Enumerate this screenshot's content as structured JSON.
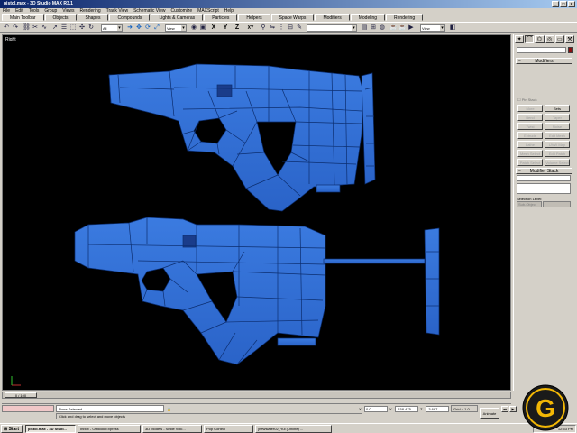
{
  "window": {
    "title": "pistol.max - 3D Studio MAX R3.1",
    "controls": [
      "_",
      "□",
      "×"
    ]
  },
  "menu": [
    "File",
    "Edit",
    "Tools",
    "Group",
    "Views",
    "Rendering",
    "Track View",
    "Schematic View",
    "Customize",
    "MAXScript",
    "Help"
  ],
  "tabs": [
    "Main Toolbar",
    "Objects",
    "Shapes",
    "Compounds",
    "Lights & Cameras",
    "Particles",
    "Helpers",
    "Space Warps",
    "Modifiers",
    "Modeling",
    "Rendering"
  ],
  "toolbar": {
    "selection_filter": "All",
    "ref_coord": "View",
    "axis_x": "X",
    "axis_y": "Y",
    "axis_z": "Z",
    "axis_xy": "XY",
    "named_selection": "",
    "render_view": "View"
  },
  "viewport": {
    "label": "Right",
    "background": "#000000",
    "model_color": "#2f6ed6"
  },
  "command_panel": {
    "tabs": [
      "create-icon",
      "modify-icon",
      "hierarchy-icon",
      "motion-icon",
      "display-icon",
      "utilities-icon"
    ],
    "object_color": "#8a1010",
    "modifiers_rollout": "Modifiers",
    "pin_stack": "Pin Stack",
    "modifier_buttons": [
      {
        "label": "More",
        "enabled": false
      },
      {
        "label": "Sets",
        "enabled": true
      },
      {
        "label": "Bend",
        "enabled": false
      },
      {
        "label": "Taper",
        "enabled": false
      },
      {
        "label": "Twist",
        "enabled": false
      },
      {
        "label": "Noise",
        "enabled": false
      },
      {
        "label": "Extrude",
        "enabled": false
      },
      {
        "label": "Edit Mesh",
        "enabled": false
      },
      {
        "label": "Lathe",
        "enabled": false
      },
      {
        "label": "UVW Map",
        "enabled": false
      },
      {
        "label": "Mesh Select",
        "enabled": false
      },
      {
        "label": "Edit Patch",
        "enabled": false
      },
      {
        "label": "Patch Select",
        "enabled": false
      },
      {
        "label": "Volume Select",
        "enabled": false
      }
    ],
    "stack_rollout": "Modifier Stack",
    "selection_level_label": "Selection Level:",
    "sub_object": "Sub-Object"
  },
  "time_slider": {
    "label": "0 / 100"
  },
  "status": {
    "selection": "None Selected",
    "prompt": "Click and drag to select and move objects",
    "x_label": "X",
    "x_value": "0.0",
    "y_label": "Y",
    "y_value": "-158.475",
    "z_label": "Z",
    "z_value": "-3.697",
    "grid": "Grid = 1.0",
    "animate": "Animate"
  },
  "taskbar": {
    "start": "Start",
    "tasks": [
      {
        "label": "pistol.max - 3D Studi...",
        "active": true
      },
      {
        "label": "Inbox - Outlook Express",
        "active": false
      },
      {
        "label": "3D Models - Smile Voic...",
        "active": false
      },
      {
        "label": "Pop Control",
        "active": false
      },
      {
        "label": "[newslater02_Yui (Online) ...",
        "active": false
      }
    ],
    "clock": "12:53 PM"
  },
  "brand": {
    "logo_letter": "G",
    "logo_color": "#f2b705"
  }
}
